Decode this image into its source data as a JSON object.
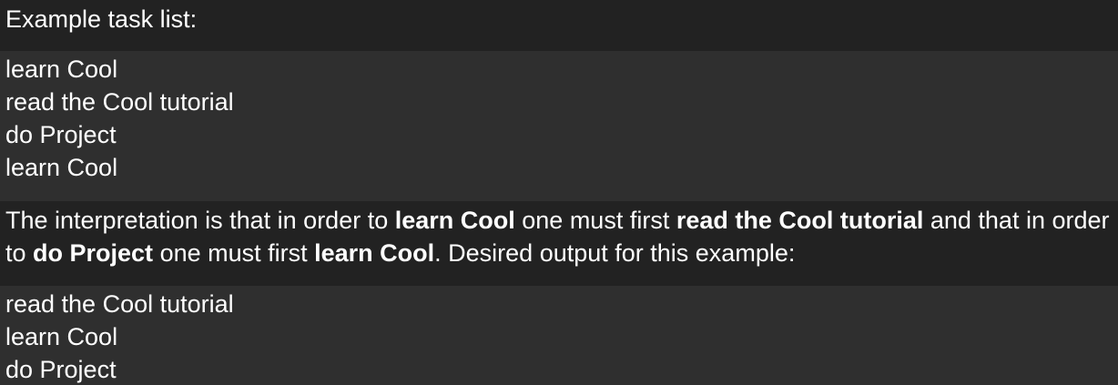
{
  "intro": {
    "text": "Example task list:"
  },
  "task_list": [
    "learn Cool",
    "read the Cool tutorial",
    "do Project",
    "learn Cool"
  ],
  "explanation": {
    "p1": "The interpretation is that in order to ",
    "b1": "learn Cool",
    "p2": " one must first ",
    "b2": "read the Cool tutorial",
    "p3": " and that in order to ",
    "b3": "do Project",
    "p4": " one must first ",
    "b4": "learn Cool",
    "p5": ". Desired output for this example:"
  },
  "output_list": [
    "read the Cool tutorial",
    "learn Cool",
    "do Project"
  ],
  "colors": {
    "background": "#222222",
    "code_background": "#2f2f2f",
    "text": "#ffffff"
  }
}
